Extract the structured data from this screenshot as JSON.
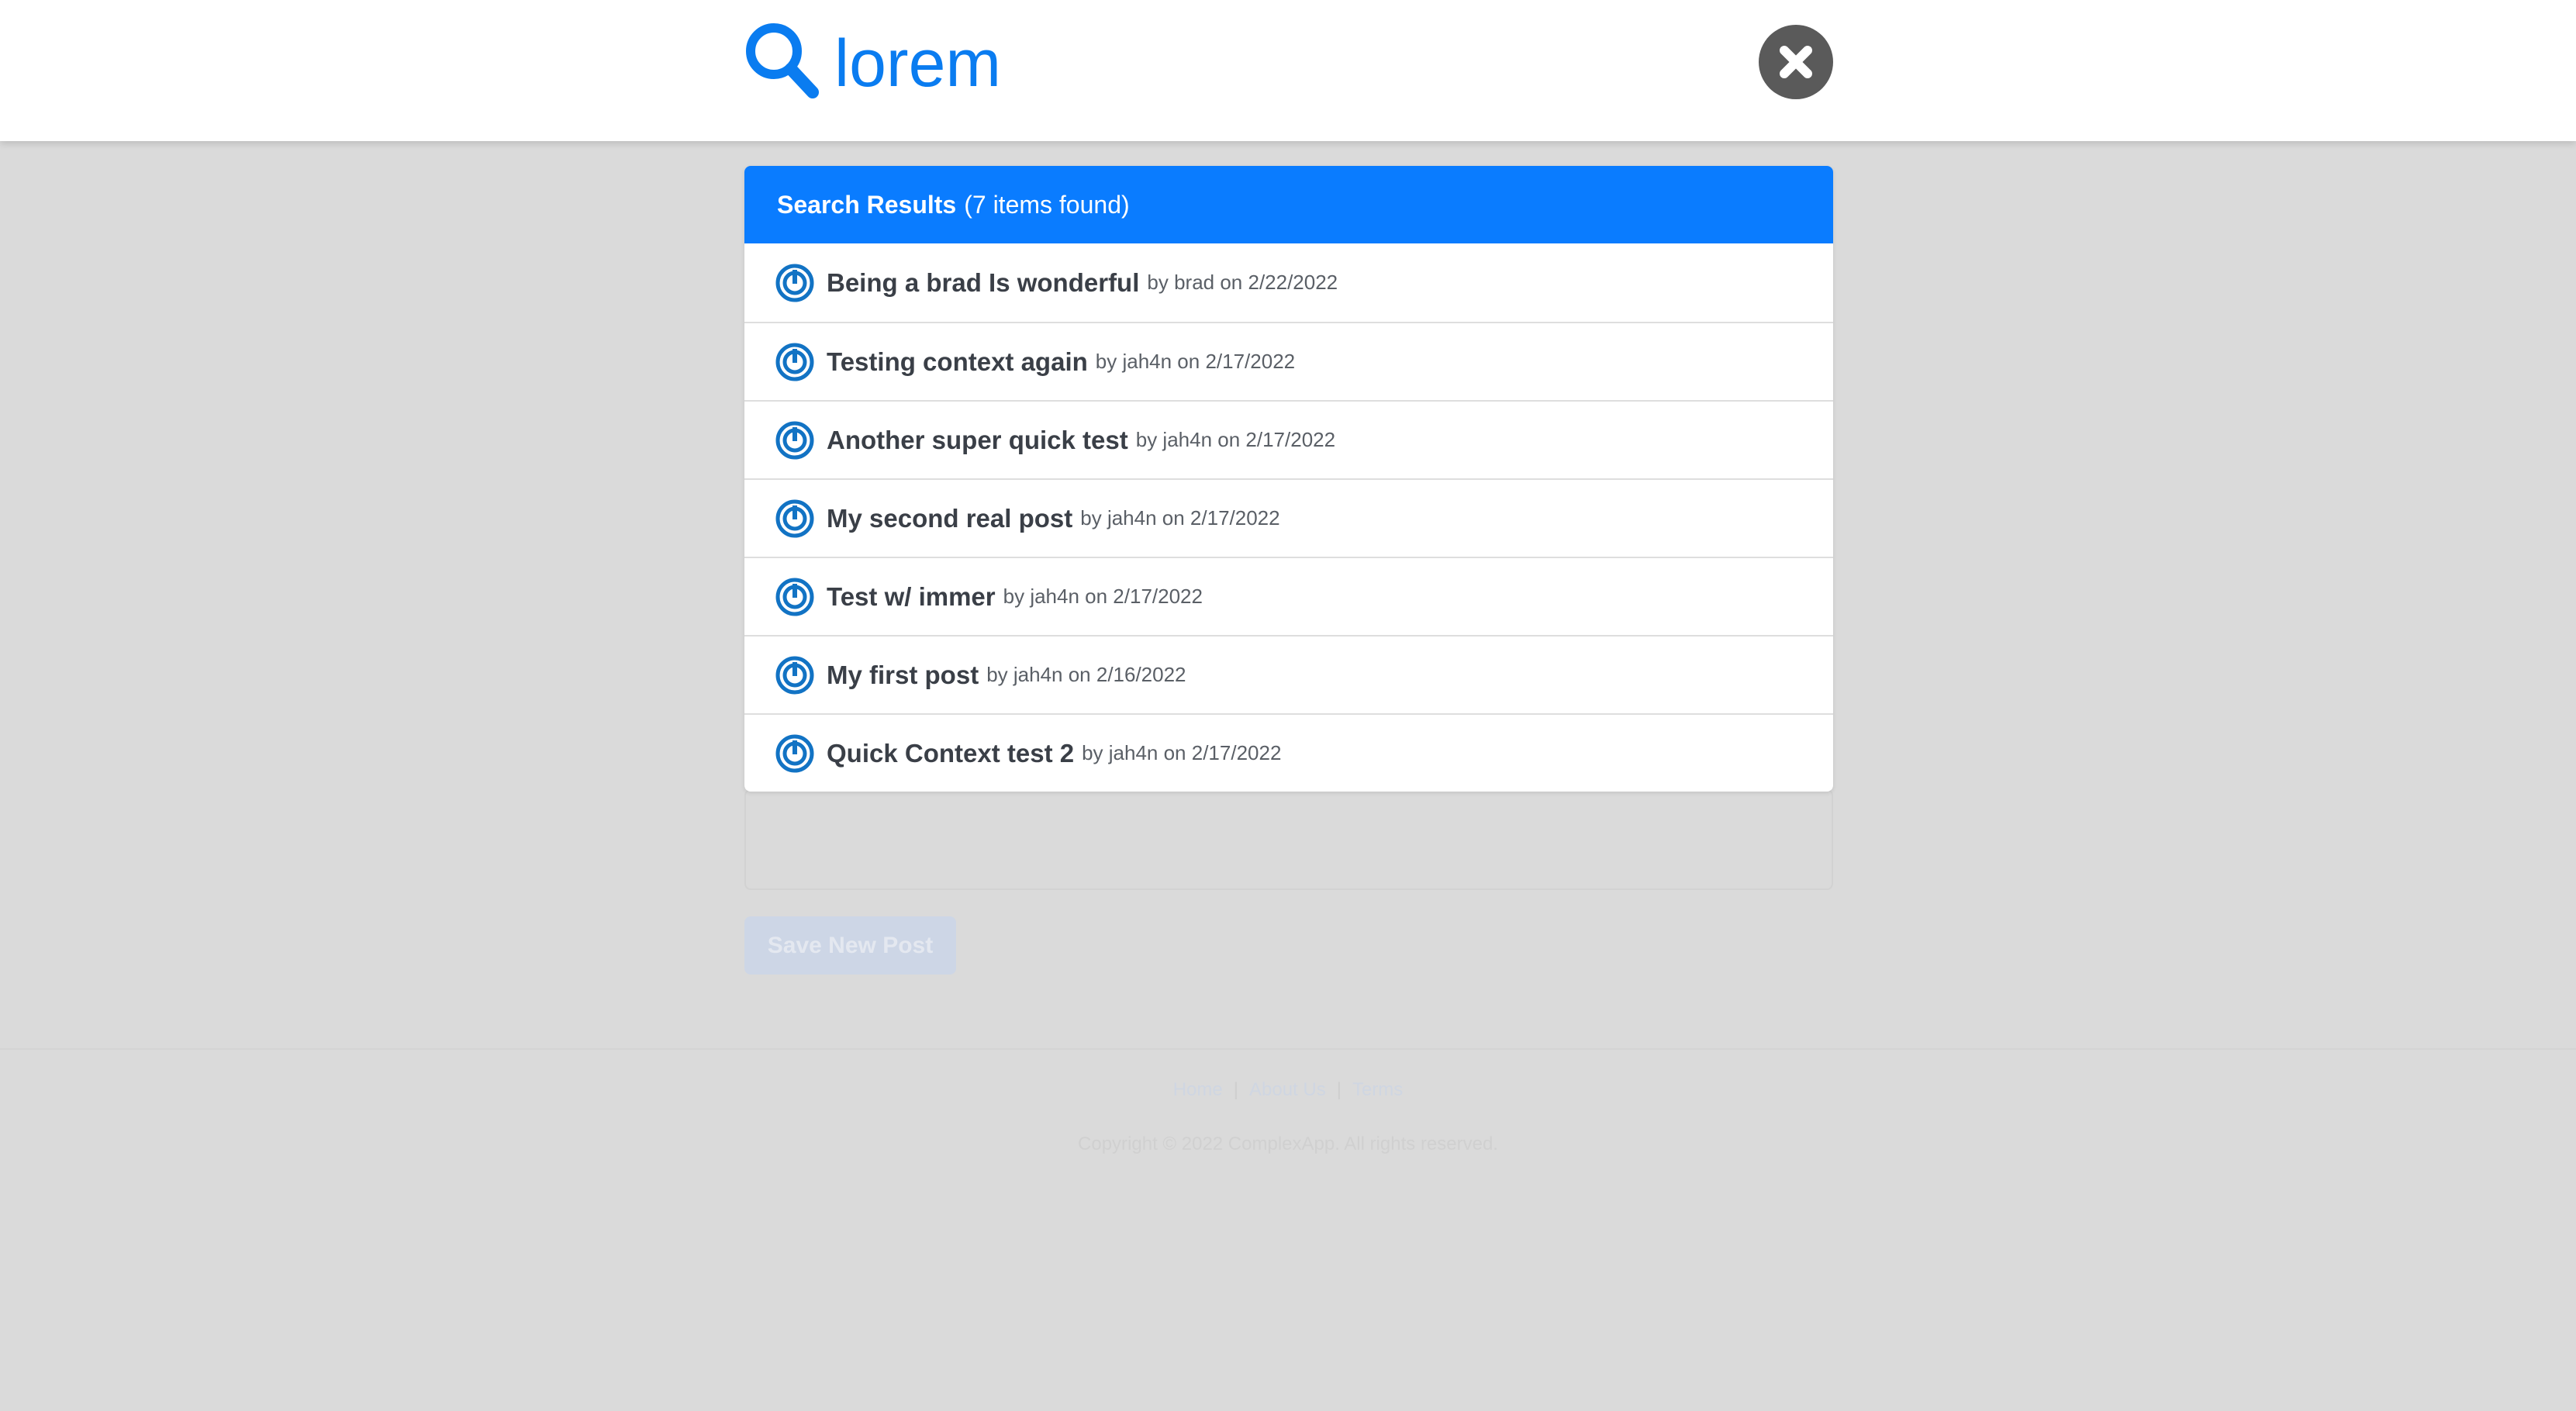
{
  "search": {
    "query": "lorem"
  },
  "results": {
    "heading": "Search Results",
    "count_text": "(7 items found)",
    "items": [
      {
        "title": "Being a brad Is wonderful",
        "meta": "by brad on 2/22/2022"
      },
      {
        "title": "Testing context again",
        "meta": "by jah4n on 2/17/2022"
      },
      {
        "title": "Another super quick test",
        "meta": "by jah4n on 2/17/2022"
      },
      {
        "title": "My second real post",
        "meta": "by jah4n on 2/17/2022"
      },
      {
        "title": "Test w/ immer",
        "meta": "by jah4n on 2/17/2022"
      },
      {
        "title": "My first post",
        "meta": "by jah4n on 2/16/2022"
      },
      {
        "title": "Quick Context test 2",
        "meta": "by jah4n on 2/17/2022"
      }
    ]
  },
  "background": {
    "save_button": "Save New Post",
    "footer_links": [
      "Home",
      "About Us",
      "Terms"
    ],
    "copyright": "Copyright © 2022 ComplexApp. All rights reserved."
  },
  "icons": {
    "search": "search-icon",
    "close": "close-icon",
    "avatar": "avatar-icon"
  },
  "colors": {
    "accent": "#0a7cff",
    "search_text": "#0a7cf0",
    "close_bg": "#5a5a5a",
    "overlay_bg": "#dadada"
  }
}
